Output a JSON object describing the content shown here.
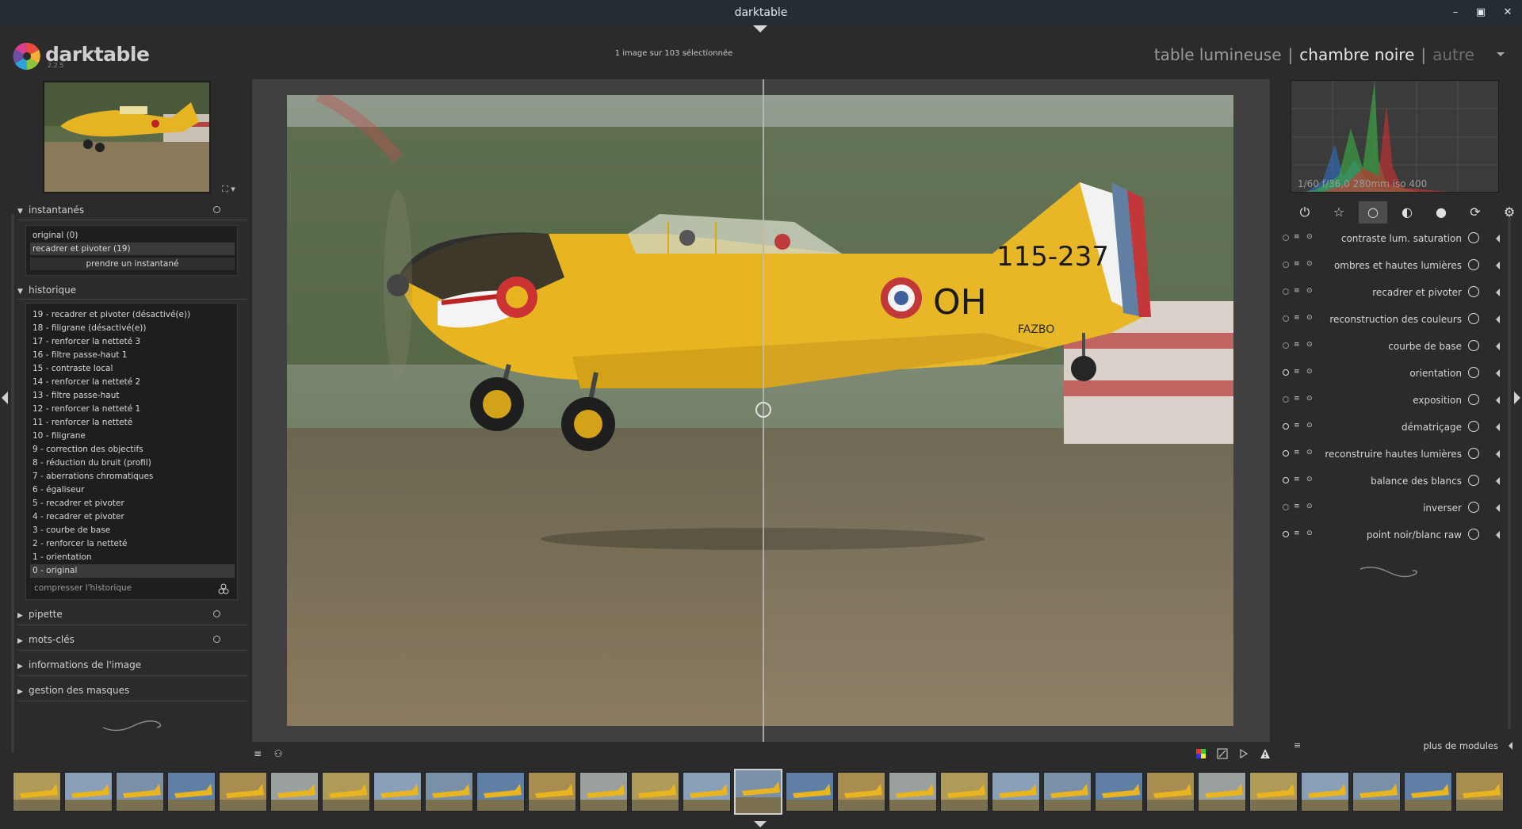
{
  "window": {
    "title": "darktable",
    "minimize": "–",
    "maximize": "▣",
    "close": "✕"
  },
  "header": {
    "logo_text": "darktable",
    "version": "2.2.5",
    "selection_info": "1 image sur 103 sélectionnée",
    "views": {
      "lighttable": "table lumineuse",
      "darkroom": "chambre noire",
      "other": "autre",
      "separator": "|"
    }
  },
  "left": {
    "navigator_zoom": "⛶ ▾",
    "snapshots": {
      "title": "instantanés",
      "items": [
        "original (0)",
        "recadrer et pivoter (19)"
      ],
      "take_button": "prendre un instantané"
    },
    "history": {
      "title": "historique",
      "items": [
        "19 - recadrer et pivoter (désactivé(e))",
        "18 - filigrane (désactivé(e))",
        "17 - renforcer la netteté 3",
        "16 - filtre passe-haut 1",
        "15 - contraste local",
        "14 - renforcer la netteté 2",
        "13 - filtre passe-haut",
        "12 - renforcer la netteté 1",
        "11 - renforcer la netteté",
        "10 - filigrane",
        "9 - correction des objectifs",
        "8 - réduction du bruit (profil)",
        "7 - aberrations chromatiques",
        "6 - égaliseur",
        "5 - recadrer et pivoter",
        "4 - recadrer et pivoter",
        "3 - courbe de base",
        "2 - renforcer la netteté",
        "1 - orientation",
        "0 - original"
      ],
      "compress": "compresser l'historique"
    },
    "collapsed_sections": [
      "pipette",
      "mots-clés",
      "informations de l'image",
      "gestion des masques"
    ]
  },
  "right": {
    "histogram_info": "1/60 f/36,0 280mm iso 400",
    "group_icons": [
      "power-icon",
      "star-icon",
      "circle-icon",
      "half-circle-icon",
      "color-circle-icon",
      "correct-icon",
      "effect-icon"
    ],
    "modules": [
      {
        "name": "contraste lum. saturation",
        "on": false
      },
      {
        "name": "ombres et hautes lumières",
        "on": false
      },
      {
        "name": "recadrer et pivoter",
        "on": false
      },
      {
        "name": "reconstruction des couleurs",
        "on": false
      },
      {
        "name": "courbe de base",
        "on": false
      },
      {
        "name": "orientation",
        "on": true
      },
      {
        "name": "exposition",
        "on": false
      },
      {
        "name": "dématriçage",
        "on": true
      },
      {
        "name": "reconstruire hautes lumières",
        "on": true
      },
      {
        "name": "balance des blancs",
        "on": true
      },
      {
        "name": "inverser",
        "on": false
      },
      {
        "name": "point noir/blanc raw",
        "on": true
      }
    ],
    "more_modules": "plus de modules",
    "more_icon": "≡"
  },
  "bottom": {
    "menu_icon": "≡",
    "styles_icon": "⚇",
    "filmstrip_count": 29,
    "selected_index": 14
  }
}
